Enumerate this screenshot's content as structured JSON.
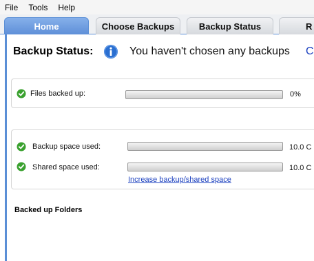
{
  "menu": {
    "items": [
      "File",
      "Tools",
      "Help"
    ]
  },
  "tabs": [
    {
      "label": "Home",
      "active": true
    },
    {
      "label": "Choose Backups",
      "active": false
    },
    {
      "label": "Backup Status",
      "active": false
    },
    {
      "label": "R",
      "active": false
    }
  ],
  "status": {
    "title": "Backup Status:",
    "message": "You haven't chosen any backups",
    "link_partial": "C"
  },
  "files_backed_up": {
    "label": "Files backed up:",
    "value": "0%",
    "progress": 0
  },
  "space": {
    "backup": {
      "label": "Backup space used:",
      "value": "10.0 C",
      "progress": 0
    },
    "shared": {
      "label": "Shared space used:",
      "value": "10.0 C",
      "progress": 0
    },
    "increase_link": "Increase backup/shared space"
  },
  "folders": {
    "heading": "Backed up Folders"
  },
  "colors": {
    "accent": "#5b8fd6",
    "check": "#3aa12f",
    "info": "#2a6fd1",
    "link": "#1a3fbf"
  }
}
